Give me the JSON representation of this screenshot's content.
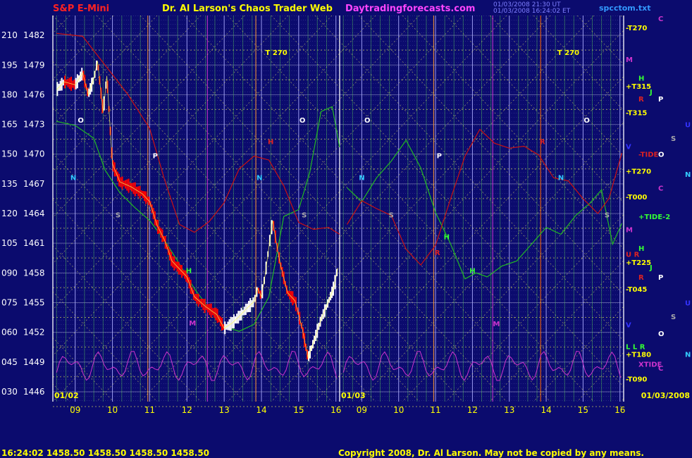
{
  "header": {
    "symbol": "S&P E-Mini",
    "title": "Dr. Al Larson's Chaos Trader Web",
    "site": "Daytradingforecasts.com",
    "datetime": "01/03/2008 21:30 UT",
    "datetime2": "01/03/2008 16:24:02 ET",
    "file": "spcctom.txt"
  },
  "footer": {
    "quote": "16:24:02  1458.50  1458.50  1458.50  1458.50",
    "copyright": "Copyright 2008, Dr. Al Larson. May not be copied by any means."
  },
  "colors": {
    "background": "#0b0b6e",
    "price_up": "#ffffff",
    "price_down": "#ff0000",
    "grid_time": "#33ff33",
    "grid_price": "#ffff00",
    "session_break": "#ffffff",
    "red_line": "#cc1111",
    "green_line": "#22bb22",
    "magenta_line": "#cc33cc"
  },
  "chart_data": {
    "type": "line",
    "title": "S&P E-Mini",
    "y_axis": {
      "range": [
        1445,
        1484
      ],
      "ticks": [
        {
          "code": "210",
          "price": 1482
        },
        {
          "code": "195",
          "price": 1479
        },
        {
          "code": "180",
          "price": 1476
        },
        {
          "code": "165",
          "price": 1473
        },
        {
          "code": "150",
          "price": 1470
        },
        {
          "code": "135",
          "price": 1467
        },
        {
          "code": "120",
          "price": 1464
        },
        {
          "code": "105",
          "price": 1461
        },
        {
          "code": "090",
          "price": 1458
        },
        {
          "code": "075",
          "price": 1455
        },
        {
          "code": "060",
          "price": 1452
        },
        {
          "code": "045",
          "price": 1449
        },
        {
          "code": "030",
          "price": 1446
        }
      ]
    },
    "x_axis": {
      "range": [
        8.4,
        16.1
      ],
      "day1_hours": [
        "09",
        "10",
        "11",
        "12",
        "13",
        "14",
        "15",
        "16"
      ],
      "day2_hours": [
        "09",
        "10",
        "11",
        "12",
        "13",
        "14",
        "15",
        "16"
      ],
      "day1_label": "01/02",
      "day2_label": "01/03",
      "end_label": "01/03/2008"
    },
    "series": [
      {
        "kind": "price",
        "day": 1,
        "hours": [
          8.5,
          8.7,
          9.0,
          9.2,
          9.35,
          9.5,
          9.6,
          9.75,
          9.85,
          10.0,
          10.2,
          10.5,
          10.8,
          11.0,
          11.2,
          11.4,
          11.6,
          11.8,
          12.0,
          12.2,
          12.5,
          12.8,
          13.0,
          13.2,
          13.4,
          13.6,
          13.8,
          13.9,
          14.0,
          14.1,
          14.2,
          14.3,
          14.4,
          14.5,
          14.7,
          14.9,
          15.0,
          15.1,
          15.25,
          15.4,
          15.6,
          15.8,
          15.95,
          16.05
        ],
        "close": [
          1476.5,
          1477.3,
          1477.0,
          1478.2,
          1476.0,
          1477.6,
          1479.4,
          1474.2,
          1477.9,
          1469.0,
          1467.2,
          1466.7,
          1466.0,
          1465.2,
          1462.8,
          1461.3,
          1459.2,
          1458.4,
          1457.6,
          1455.6,
          1454.6,
          1453.8,
          1452.4,
          1452.9,
          1453.6,
          1454.4,
          1455.1,
          1456.4,
          1455.6,
          1457.8,
          1460.6,
          1463.3,
          1461.1,
          1459.0,
          1456.0,
          1455.2,
          1453.8,
          1452.3,
          1449.4,
          1451.0,
          1453.3,
          1455.1,
          1456.6,
          1458.5
        ]
      },
      {
        "kind": "green_wave",
        "points": [
          [
            8.5,
            1473.3
          ],
          [
            9.0,
            1472.9
          ],
          [
            9.5,
            1471.6
          ],
          [
            9.8,
            1468.4
          ],
          [
            10.2,
            1466.1
          ],
          [
            10.6,
            1464.6
          ],
          [
            11.0,
            1463.3
          ],
          [
            11.4,
            1461.3
          ],
          [
            11.8,
            1458.9
          ],
          [
            12.2,
            1456.4
          ],
          [
            12.6,
            1454.4
          ],
          [
            13.0,
            1452.6
          ],
          [
            13.4,
            1452.1
          ],
          [
            13.8,
            1452.8
          ],
          [
            14.2,
            1455.6
          ],
          [
            14.6,
            1463.7
          ],
          [
            15.0,
            1464.4
          ],
          [
            15.3,
            1468.2
          ],
          [
            15.6,
            1474.3
          ],
          [
            15.9,
            1474.8
          ],
          [
            16.1,
            1470.7
          ]
        ],
        "day2_points": [
          [
            8.6,
            1466.6
          ],
          [
            9.0,
            1465.2
          ],
          [
            9.4,
            1467.6
          ],
          [
            9.8,
            1469.3
          ],
          [
            10.2,
            1471.4
          ],
          [
            10.6,
            1468.6
          ],
          [
            11.0,
            1464.1
          ],
          [
            11.4,
            1461.0
          ],
          [
            11.8,
            1457.4
          ],
          [
            12.1,
            1458.0
          ],
          [
            12.4,
            1457.6
          ],
          [
            12.8,
            1458.7
          ],
          [
            13.2,
            1459.2
          ],
          [
            13.6,
            1460.9
          ],
          [
            14.0,
            1462.6
          ],
          [
            14.4,
            1461.9
          ],
          [
            14.8,
            1463.8
          ],
          [
            15.2,
            1465.1
          ],
          [
            15.5,
            1466.4
          ],
          [
            15.8,
            1460.9
          ],
          [
            16.05,
            1463.0
          ]
        ]
      },
      {
        "kind": "red_wave",
        "points": [
          [
            8.5,
            1482.2
          ],
          [
            9.2,
            1481.9
          ],
          [
            9.8,
            1479.0
          ],
          [
            10.4,
            1476.1
          ],
          [
            11.0,
            1472.6
          ],
          [
            11.4,
            1467.4
          ],
          [
            11.8,
            1462.9
          ],
          [
            12.2,
            1462.1
          ],
          [
            12.6,
            1463.2
          ],
          [
            13.0,
            1465.1
          ],
          [
            13.4,
            1468.5
          ],
          [
            13.8,
            1469.8
          ],
          [
            14.2,
            1469.4
          ],
          [
            14.6,
            1466.8
          ],
          [
            15.0,
            1463.1
          ],
          [
            15.4,
            1462.4
          ],
          [
            15.8,
            1462.6
          ],
          [
            16.1,
            1461.9
          ]
        ],
        "day2_points": [
          [
            8.6,
            1462.9
          ],
          [
            9.0,
            1465.3
          ],
          [
            9.4,
            1464.5
          ],
          [
            9.8,
            1463.8
          ],
          [
            10.2,
            1460.4
          ],
          [
            10.6,
            1458.8
          ],
          [
            11.0,
            1460.8
          ],
          [
            11.4,
            1465.4
          ],
          [
            11.8,
            1469.8
          ],
          [
            12.2,
            1472.5
          ],
          [
            12.6,
            1471.1
          ],
          [
            13.0,
            1470.6
          ],
          [
            13.4,
            1470.8
          ],
          [
            13.8,
            1469.9
          ],
          [
            14.2,
            1467.6
          ],
          [
            14.6,
            1467.3
          ],
          [
            15.0,
            1465.5
          ],
          [
            15.4,
            1464.0
          ],
          [
            15.7,
            1465.5
          ],
          [
            16.05,
            1470.1
          ]
        ]
      }
    ],
    "markers": [
      {
        "text": "O",
        "hour": 9.15,
        "price": 1473.2,
        "color": "#ffffff"
      },
      {
        "text": "N",
        "hour": 8.95,
        "price": 1467.4,
        "color": "#33ccff"
      },
      {
        "text": "P",
        "hour": 11.15,
        "price": 1469.6,
        "color": "#ffffff"
      },
      {
        "text": "S",
        "hour": 10.15,
        "price": 1463.6,
        "color": "#aaaaaa"
      },
      {
        "text": "T 270",
        "hour": 14.4,
        "price": 1480.0,
        "color": "#ffff00"
      },
      {
        "text": "M",
        "hour": 12.15,
        "price": 1452.7,
        "color": "#cc33cc"
      },
      {
        "text": "H",
        "hour": 12.05,
        "price": 1458.0,
        "color": "#33ff33"
      },
      {
        "text": "H",
        "hour": 14.25,
        "price": 1471.0,
        "color": "#dd2222"
      },
      {
        "text": "O",
        "hour": 15.1,
        "price": 1473.2,
        "color": "#ffffff"
      },
      {
        "text": "N",
        "hour": 13.95,
        "price": 1467.4,
        "color": "#33ccff"
      },
      {
        "text": "S",
        "hour": 15.15,
        "price": 1463.6,
        "color": "#aaaaaa"
      },
      {
        "text": "N",
        "hour": 9.0,
        "price": 1467.4,
        "color": "#33ccff"
      },
      {
        "text": "O",
        "hour": 9.15,
        "price": 1473.2,
        "color": "#ffffff"
      },
      {
        "text": "S",
        "hour": 9.8,
        "price": 1463.6,
        "color": "#aaaaaa"
      },
      {
        "text": "P",
        "hour": 11.1,
        "price": 1469.6,
        "color": "#ffffff"
      },
      {
        "text": "M",
        "hour": 12.65,
        "price": 1452.6,
        "color": "#cc33cc"
      },
      {
        "text": "H",
        "hour": 11.3,
        "price": 1461.4,
        "color": "#33ff33"
      },
      {
        "text": "H",
        "hour": 12.0,
        "price": 1458.0,
        "color": "#33ff33"
      },
      {
        "text": "R",
        "hour": 11.05,
        "price": 1459.8,
        "color": "#dd2222"
      },
      {
        "text": "T 270",
        "hour": 14.6,
        "price": 1480.0,
        "color": "#ffff00"
      },
      {
        "text": "R",
        "hour": 13.9,
        "price": 1471.0,
        "color": "#dd2222"
      },
      {
        "text": "N",
        "hour": 14.4,
        "price": 1467.4,
        "color": "#33ccff"
      },
      {
        "text": "O",
        "hour": 15.1,
        "price": 1473.2,
        "color": "#ffffff"
      },
      {
        "text": "S",
        "hour": 15.65,
        "price": 1463.6,
        "color": "#aaaaaa"
      }
    ],
    "right_labels": [
      {
        "text": "-T270",
        "price": 1482.8,
        "color": "#ffff00",
        "col": 0
      },
      {
        "text": "C",
        "price": 1483.7,
        "color": "#cc33cc",
        "col": 3
      },
      {
        "text": "M",
        "price": 1479.6,
        "color": "#cc33cc",
        "col": 0
      },
      {
        "text": "H",
        "price": 1477.7,
        "color": "#33ff33",
        "col": 1
      },
      {
        "text": "+T315",
        "price": 1476.9,
        "color": "#ffff00",
        "col": 0
      },
      {
        "text": "J",
        "price": 1476.3,
        "color": "#33ff33",
        "col": 2
      },
      {
        "text": "R",
        "price": 1475.6,
        "color": "#dd2222",
        "col": 1
      },
      {
        "text": "P",
        "price": 1475.6,
        "color": "#ffffff",
        "col": 3
      },
      {
        "text": "-T315",
        "price": 1474.2,
        "color": "#ffff00",
        "col": 0
      },
      {
        "text": "U",
        "price": 1473.0,
        "color": "#3333ff",
        "col": 5
      },
      {
        "text": "S",
        "price": 1471.6,
        "color": "#aaaaaa",
        "col": 4
      },
      {
        "text": "V",
        "price": 1470.8,
        "color": "#3333ff",
        "col": 0
      },
      {
        "text": "-TIDE",
        "price": 1470.0,
        "color": "#dd2222",
        "col": 1
      },
      {
        "text": "O",
        "price": 1470.0,
        "color": "#ffffff",
        "col": 3
      },
      {
        "text": "+T270",
        "price": 1468.3,
        "color": "#ffff00",
        "col": 0
      },
      {
        "text": "N",
        "price": 1468.0,
        "color": "#33ccff",
        "col": 5
      },
      {
        "text": "C",
        "price": 1466.6,
        "color": "#cc33cc",
        "col": 3
      },
      {
        "text": "-T000",
        "price": 1465.7,
        "color": "#ffff00",
        "col": 0
      },
      {
        "text": "+TIDE-2",
        "price": 1463.7,
        "color": "#33ff33",
        "col": 1
      },
      {
        "text": "M",
        "price": 1462.4,
        "color": "#cc33cc",
        "col": 0
      },
      {
        "text": "H",
        "price": 1460.5,
        "color": "#33ff33",
        "col": 1
      },
      {
        "text": "U R",
        "price": 1459.9,
        "color": "#dd2222",
        "col": 0
      },
      {
        "text": "+T225",
        "price": 1459.1,
        "color": "#ffff00",
        "col": 0
      },
      {
        "text": "J",
        "price": 1458.6,
        "color": "#33ff33",
        "col": 2
      },
      {
        "text": "R",
        "price": 1457.6,
        "color": "#dd2222",
        "col": 1
      },
      {
        "text": "P",
        "price": 1457.6,
        "color": "#ffffff",
        "col": 3
      },
      {
        "text": "-T045",
        "price": 1456.4,
        "color": "#ffff00",
        "col": 0
      },
      {
        "text": "U",
        "price": 1455.0,
        "color": "#3333ff",
        "col": 5
      },
      {
        "text": "S",
        "price": 1453.6,
        "color": "#aaaaaa",
        "col": 4
      },
      {
        "text": "V",
        "price": 1452.8,
        "color": "#3333ff",
        "col": 0
      },
      {
        "text": "O",
        "price": 1451.9,
        "color": "#ffffff",
        "col": 3
      },
      {
        "text": "L L R",
        "price": 1450.6,
        "color": "#33ff33",
        "col": 0
      },
      {
        "text": "+T180",
        "price": 1449.8,
        "color": "#ffff00",
        "col": 0
      },
      {
        "text": "N",
        "price": 1449.8,
        "color": "#33ccff",
        "col": 5
      },
      {
        "text": "XTIDE",
        "price": 1448.8,
        "color": "#cc33cc",
        "col": 1
      },
      {
        "text": "C",
        "price": 1448.4,
        "color": "#cc33cc",
        "col": 3
      },
      {
        "text": "-T090",
        "price": 1447.3,
        "color": "#ffff00",
        "col": 0
      }
    ]
  }
}
